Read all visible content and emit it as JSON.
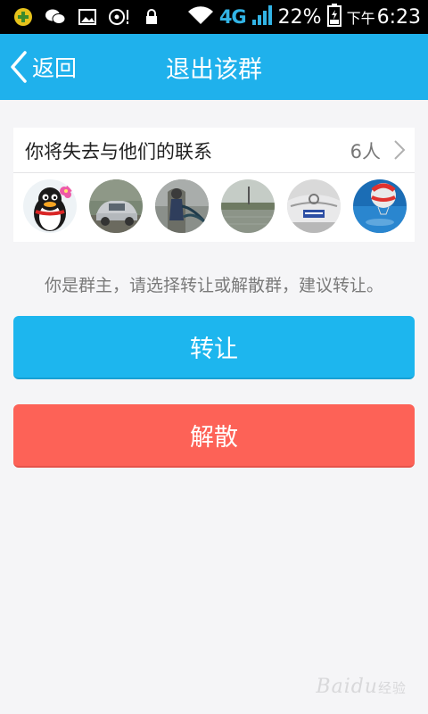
{
  "status_bar": {
    "network": "4G",
    "battery": "22%",
    "time_prefix": "下午",
    "time": "6:23"
  },
  "header": {
    "back_label": "返回",
    "title": "退出该群"
  },
  "members": {
    "label": "你将失去与他们的联系",
    "count": "6人",
    "avatars": [
      "penguin",
      "car-gray",
      "person-outdoor",
      "lake",
      "car-white-plate",
      "balloon"
    ]
  },
  "owner_tip": "你是群主，请选择转让或解散群，建议转让。",
  "buttons": {
    "transfer": "转让",
    "dissolve": "解散"
  },
  "colors": {
    "header": "#1fb1ec",
    "transfer": "#1db6ee",
    "dissolve": "#fd6257",
    "background": "#f5f5f7"
  },
  "watermark": {
    "text": "Baidu",
    "suffix": "经验"
  }
}
